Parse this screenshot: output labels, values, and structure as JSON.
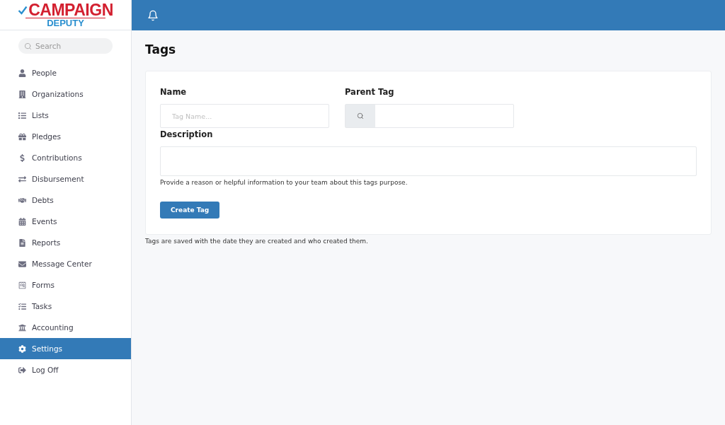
{
  "logo": {
    "top": "CAMPAIGN",
    "bottom": "DEPUTY"
  },
  "search": {
    "placeholder": "Search"
  },
  "sidebar": {
    "items": [
      {
        "label": "People",
        "selected": false
      },
      {
        "label": "Organizations",
        "selected": false
      },
      {
        "label": "Lists",
        "selected": false
      },
      {
        "label": "Pledges",
        "selected": false
      },
      {
        "label": "Contributions",
        "selected": false
      },
      {
        "label": "Disbursement",
        "selected": false
      },
      {
        "label": "Debts",
        "selected": false
      },
      {
        "label": "Events",
        "selected": false
      },
      {
        "label": "Reports",
        "selected": false
      },
      {
        "label": "Message Center",
        "selected": false
      },
      {
        "label": "Forms",
        "selected": false
      },
      {
        "label": "Tasks",
        "selected": false
      },
      {
        "label": "Accounting",
        "selected": false
      },
      {
        "label": "Settings",
        "selected": true
      },
      {
        "label": "Log Off",
        "selected": false
      }
    ]
  },
  "page": {
    "title": "Tags",
    "form": {
      "name_label": "Name",
      "name_placeholder": "Tag Name...",
      "parent_label": "Parent Tag",
      "description_label": "Description",
      "description_help": "Provide a reason or helpful information to your team about this tags purpose.",
      "submit": "Create Tag"
    },
    "footnote": "Tags are saved with the date they are created and who created them."
  }
}
